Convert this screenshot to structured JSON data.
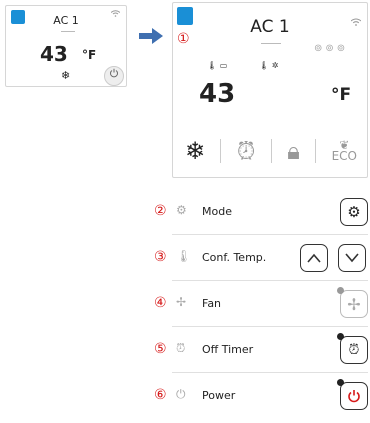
{
  "mini_card": {
    "title": "AC 1",
    "temperature": "43",
    "unit": "°F"
  },
  "big_card": {
    "title": "AC 1",
    "temperature": "43",
    "unit": "°F",
    "eco_label": "ECO"
  },
  "markers": [
    "①",
    "②",
    "③",
    "④",
    "⑤",
    "⑥"
  ],
  "controls": [
    {
      "label": "Mode",
      "icon": "gear-icon"
    },
    {
      "label": "Conf. Temp.",
      "icon": "thermometer-icon"
    },
    {
      "label": "Fan",
      "icon": "fan-icon"
    },
    {
      "label": "Off Timer",
      "icon": "alarm-clock-icon"
    },
    {
      "label": "Power",
      "icon": "power-icon"
    }
  ],
  "colors": {
    "accent_blue": "#1a8fd6",
    "marker_red": "#d61a1a",
    "power_red": "#d61a1a"
  }
}
